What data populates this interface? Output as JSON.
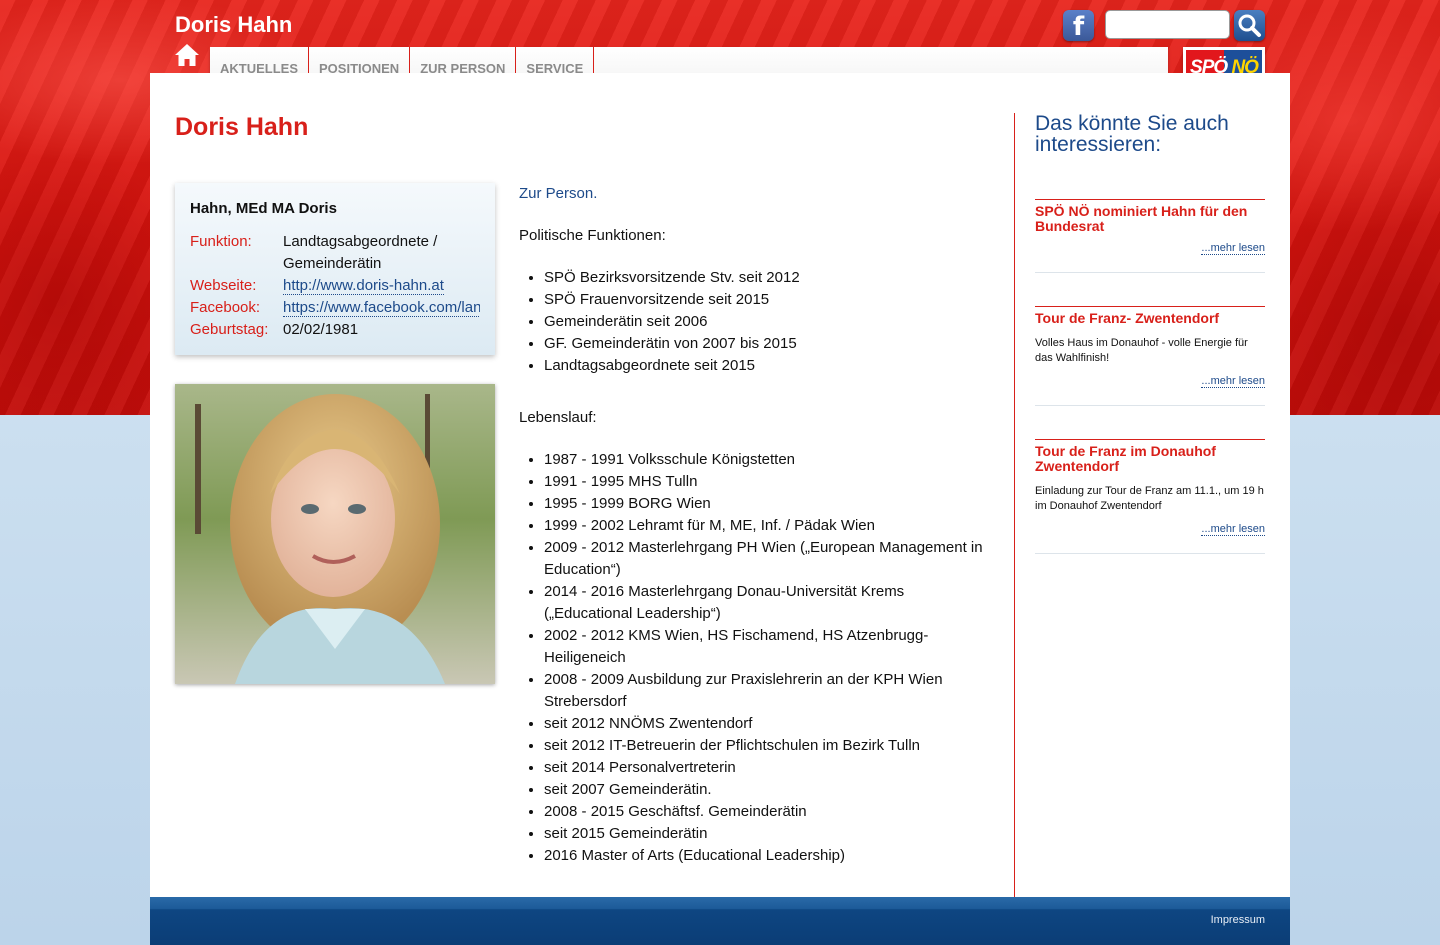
{
  "header": {
    "site_title": "Doris Hahn",
    "search_placeholder": "",
    "logo": {
      "part1": "SPÖ",
      "part2": "NÖ"
    }
  },
  "nav": {
    "items": [
      {
        "label": "AKTUELLES"
      },
      {
        "label": "POSITIONEN"
      },
      {
        "label": "ZUR PERSON"
      },
      {
        "label": "SERVICE"
      }
    ]
  },
  "page": {
    "title": "Doris Hahn"
  },
  "card": {
    "name": "Hahn, MEd MA Doris",
    "funktion_label": "Funktion:",
    "funktion_value": "Landtagsabgeordnete / Gemeinderätin",
    "webseite_label": "Webseite:",
    "webseite_value": "http://www.doris-hahn.at",
    "facebook_label": "Facebook:",
    "facebook_value": "https://www.facebook.com/lan",
    "geburtstag_label": "Geburtstag:",
    "geburtstag_value": "02/02/1981"
  },
  "content": {
    "intro": "Zur Person.",
    "politische_heading": "Politische Funktionen:",
    "politische": [
      "SPÖ Bezirksvorsitzende Stv. seit 2012",
      "SPÖ Frauenvorsitzende seit 2015",
      "Gemeinderätin seit 2006",
      "GF. Gemeinderätin von 2007 bis 2015",
      "Landtagsabgeordnete seit 2015"
    ],
    "lebenslauf_heading": "Lebenslauf:",
    "lebenslauf": [
      "1987 - 1991 Volksschule Königstetten",
      "1991 - 1995 MHS Tulln",
      "1995 - 1999 BORG Wien",
      "1999 - 2002 Lehramt für M, ME, Inf. / Pädak Wien",
      "2009 - 2012 Masterlehrgang PH Wien („European Management in Education“)",
      "2014 - 2016 Masterlehrgang Donau-Universität Krems („Educational Leadership“)",
      "2002 - 2012 KMS Wien, HS Fischamend, HS Atzenbrugg-Heiligeneich",
      "2008 - 2009 Ausbildung zur Praxislehrerin an der KPH Wien Strebersdorf",
      "seit 2012 NNÖMS Zwentendorf",
      "seit 2012 IT-Betreuerin der Pflichtschulen im Bezirk Tulln",
      "seit 2014 Personalvertreterin",
      "seit 2007 Gemeinderätin.",
      "2008 - 2015 Geschäftsf. Gemeinderätin",
      "seit 2015 Gemeinderätin",
      "2016 Master of Arts (Educational Leadership)"
    ]
  },
  "sidebar": {
    "title": "Das könnte Sie auch interessieren:",
    "news": [
      {
        "title": "SPÖ NÖ nominiert Hahn für den Bundesrat",
        "teaser": "",
        "more": "...mehr lesen"
      },
      {
        "title": "Tour de Franz- Zwentendorf",
        "teaser": "Volles Haus im Donauhof - volle Energie für das Wahlfinish!",
        "more": "...mehr lesen"
      },
      {
        "title": "Tour de Franz im Donauhof Zwentendorf",
        "teaser": "Einladung zur Tour de Franz am 11.1., um 19 h im Donauhof Zwentendorf",
        "more": "...mehr lesen"
      }
    ]
  },
  "footer": {
    "impressum": "Impressum"
  },
  "colors": {
    "accent_red": "#d8201a",
    "link_blue": "#1d4a8a",
    "footer_blue": "#0e4682"
  }
}
